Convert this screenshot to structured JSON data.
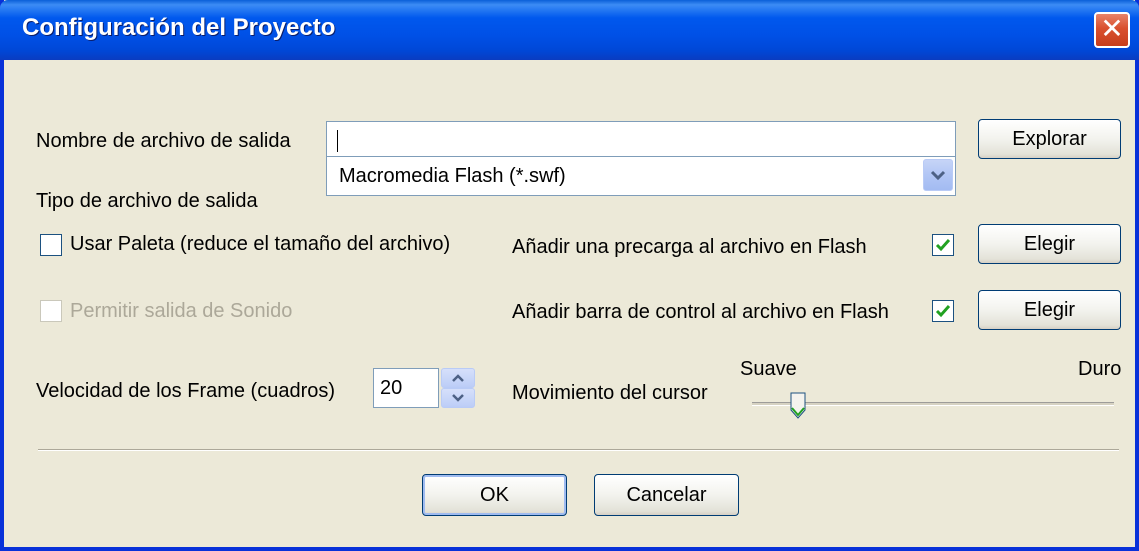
{
  "window": {
    "title": "Configuración del Proyecto",
    "close_label": "✕"
  },
  "output_file": {
    "label": "Nombre de archivo de salida",
    "value": "",
    "browse_label": "Explorar"
  },
  "output_type": {
    "label": "Tipo de archivo de salida",
    "selected": "Macromedia Flash (*.swf)"
  },
  "options": {
    "use_palette": {
      "label": "Usar Paleta (reduce el tamaño del archivo)",
      "checked": false
    },
    "allow_sound": {
      "label": "Permitir salida de Sonido",
      "checked": false,
      "enabled": false
    },
    "add_preloader": {
      "label": "Añadir una precarga al archivo en Flash",
      "checked": true,
      "button_label": "Elegir"
    },
    "add_control_bar": {
      "label": "Añadir barra de control al archivo en Flash",
      "checked": true,
      "button_label": "Elegir"
    }
  },
  "frame_rate": {
    "label": "Velocidad de los Frame (cuadros)",
    "value": "20"
  },
  "cursor_motion": {
    "label": "Movimiento del cursor",
    "min_label": "Suave",
    "max_label": "Duro",
    "level": 0.12
  },
  "buttons": {
    "ok": "OK",
    "cancel": "Cancelar"
  },
  "colors": {
    "title_bar": "#0054e3",
    "dialog_bg": "#ece9d8",
    "check_green": "#21a121",
    "close_red": "#d9502e"
  },
  "icons": {
    "dropdown": "chevron-down-icon",
    "check": "check-icon",
    "spin_up": "arrow-up-icon",
    "spin_down": "arrow-down-icon",
    "close": "close-icon"
  }
}
